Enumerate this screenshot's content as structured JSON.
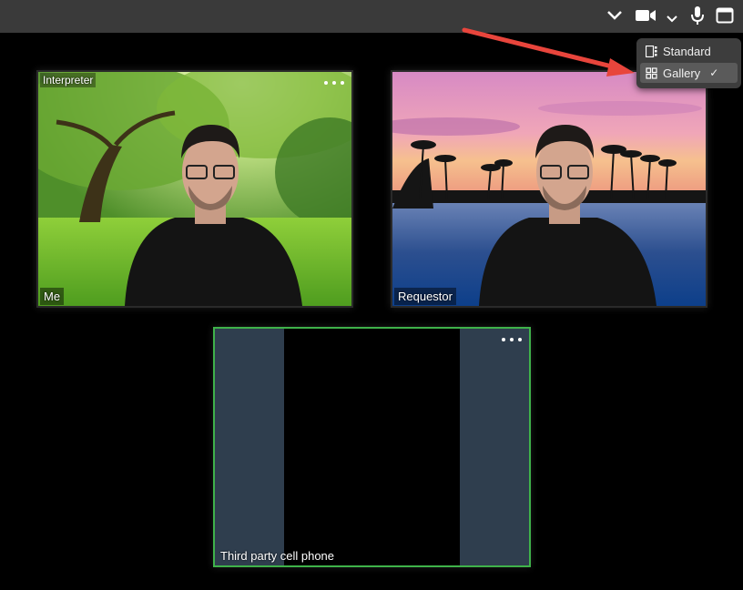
{
  "toolbar": {
    "icons": [
      "chevron-down-icon",
      "video-camera-icon",
      "chevron-down-icon",
      "microphone-icon",
      "window-icon"
    ]
  },
  "layout_menu": {
    "items": [
      {
        "label": "Standard",
        "icon": "standard-layout-icon",
        "selected": false
      },
      {
        "label": "Gallery",
        "icon": "gallery-layout-icon",
        "selected": true
      }
    ],
    "check_glyph": "✓"
  },
  "tiles": {
    "me": {
      "top_label": "Interpreter",
      "label": "Me"
    },
    "requestor": {
      "label": "Requestor"
    },
    "third_party": {
      "label": "Third party cell phone"
    }
  },
  "colors": {
    "toolbar_bg": "#3a3a3a",
    "active_border": "#3fb24a",
    "annotation_arrow": "#e8453c",
    "placeholder_bar": "#2f3e4e"
  }
}
